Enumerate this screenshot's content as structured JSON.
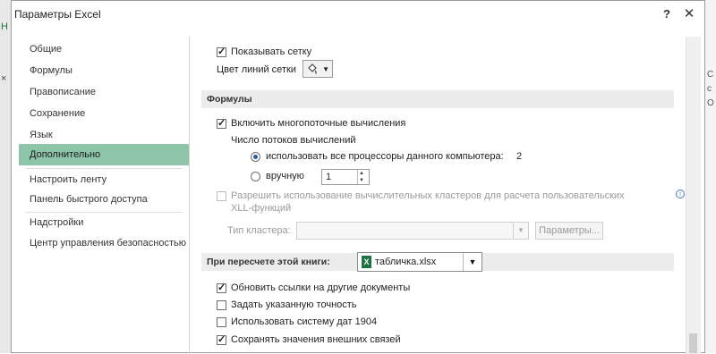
{
  "dialog": {
    "title": "Параметры Excel",
    "help": "?",
    "close": "✕"
  },
  "background": {
    "left_ticks": [
      "Н",
      "×"
    ],
    "right_ticks": [
      "С",
      "с",
      "О"
    ]
  },
  "nav": {
    "items": [
      {
        "label": "Общие"
      },
      {
        "label": "Формулы"
      },
      {
        "label": "Правописание"
      },
      {
        "label": "Сохранение"
      },
      {
        "label": "Язык"
      },
      {
        "label": "Дополнительно",
        "active": true
      },
      {
        "label": "Настроить ленту"
      },
      {
        "label": "Панель быстрого доступа"
      },
      {
        "label": "Надстройки"
      },
      {
        "label": "Центр управления безопасностью"
      }
    ]
  },
  "content": {
    "show_grid": {
      "label": "Показывать сетку",
      "checked": true
    },
    "grid_color": {
      "label": "Цвет линий сетки",
      "arrow": "▼"
    },
    "formulas_section": {
      "title": "Формулы"
    },
    "multithread": {
      "label": "Включить многопоточные вычисления",
      "checked": true
    },
    "threads_label": "Число потоков вычислений",
    "use_all": {
      "label": "использовать все процессоры данного компьютера:",
      "value": "2",
      "selected": true
    },
    "manual": {
      "label": "вручную",
      "value": "1"
    },
    "clusters": {
      "label_line1": "Разрешить использование вычислительных кластеров для расчета пользовательских",
      "label_line2": "XLL-функций",
      "checked": false
    },
    "cluster_type": {
      "label": "Тип кластера:",
      "arrow": "▼"
    },
    "params_button": "Параметры...",
    "recalc_section": {
      "title": "При пересчете этой книги:"
    },
    "workbook": {
      "value": "табличка.xlsx",
      "icon": "X",
      "arrow": "▼"
    },
    "update_links": {
      "label": "Обновить ссылки на другие документы",
      "checked": true
    },
    "precision": {
      "label": "Задать указанную точность",
      "checked": false
    },
    "date1904": {
      "label": "Использовать систему дат 1904",
      "checked": false
    },
    "save_external": {
      "label": "Сохранять значения внешних связей",
      "checked": true
    }
  },
  "colors": {
    "accent_nav": "#8dc5a8",
    "excel_green": "#1f7244"
  }
}
